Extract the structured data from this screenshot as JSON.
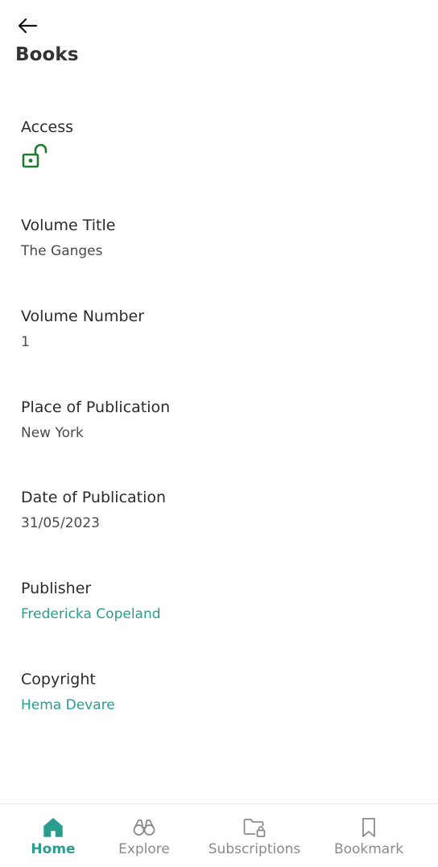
{
  "header": {
    "title": "Books"
  },
  "fields": [
    {
      "label": "Access",
      "value": "",
      "icon": "unlock-icon"
    },
    {
      "label": "Volume Title",
      "value": "The Ganges"
    },
    {
      "label": "Volume Number",
      "value": "1"
    },
    {
      "label": "Place of Publication",
      "value": "New York"
    },
    {
      "label": "Date of Publication",
      "value": "31/05/2023"
    },
    {
      "label": "Publisher",
      "value": "Fredericka Copeland"
    },
    {
      "label": "Copyright",
      "value": "Hema Devare"
    }
  ],
  "nav": {
    "items": [
      {
        "label": "Home",
        "icon": "home-icon",
        "active": true
      },
      {
        "label": "Explore",
        "icon": "binoculars-icon",
        "active": false
      },
      {
        "label": "Subscriptions",
        "icon": "locked-folder-icon",
        "active": false
      },
      {
        "label": "Bookmark",
        "icon": "bookmark-icon",
        "active": false
      }
    ]
  },
  "colors": {
    "accent": "#2a9d8f",
    "access_icon": "#1e7a2e",
    "nav_inactive": "#8a8a8a"
  }
}
